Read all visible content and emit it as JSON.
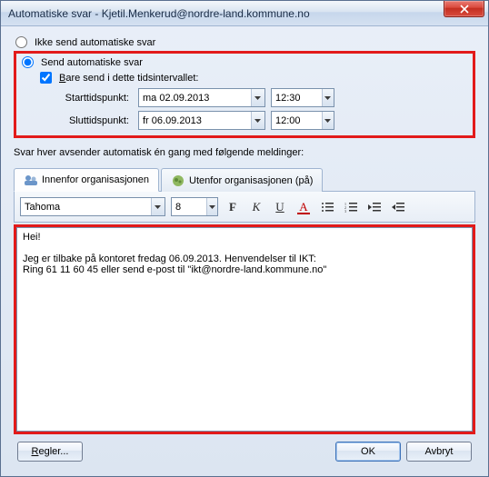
{
  "window": {
    "title": "Automatiske svar - Kjetil.Menkerud@nordre-land.kommune.no"
  },
  "radios": {
    "dont_send": "Ikke send automatiske svar",
    "send": "Send automatiske svar"
  },
  "interval": {
    "checkbox_pre": "B",
    "checkbox_rest": "are send i dette tidsintervallet:",
    "start_label": "Starttidspunkt:",
    "end_label": "Sluttidspunkt:",
    "start_date": "ma 02.09.2013",
    "start_time": "12:30",
    "end_date": "fr 06.09.2013",
    "end_time": "12:00"
  },
  "instruction": "Svar hver avsender automatisk én gang med følgende meldinger:",
  "tabs": {
    "inside": "Innenfor organisasjonen",
    "outside": "Utenfor organisasjonen (på)"
  },
  "toolbar": {
    "font": "Tahoma",
    "size": "8",
    "bold": "F",
    "italic": "K",
    "underline": "U",
    "color_letter": "A"
  },
  "message": "Hei!\n\nJeg er tilbake på kontoret fredag 06.09.2013. Henvendelser til IKT:\nRing 61 11 60 45 eller send e-post til \"ikt@nordre-land.kommune.no\"",
  "buttons": {
    "rules_pre": "R",
    "rules_rest": "egler...",
    "ok": "OK",
    "cancel": "Avbryt"
  }
}
